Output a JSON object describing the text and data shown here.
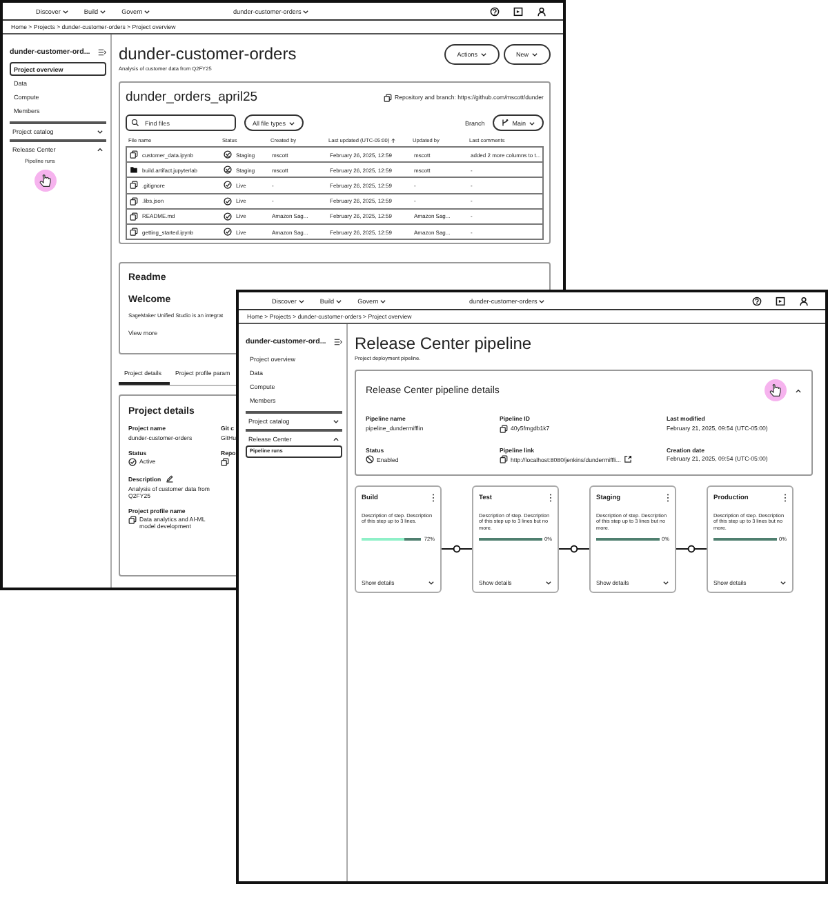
{
  "back_window": {
    "nav": {
      "menus": [
        "Discover",
        "Build",
        "Govern"
      ],
      "project": "dunder-customer-orders"
    },
    "breadcrumb": "Home > Projects > dunder-customer-orders > Project overview",
    "sidebar": {
      "project": "dunder-customer-ord...",
      "items": [
        {
          "label": "Project overview",
          "selected": true
        },
        {
          "label": "Data",
          "selected": false
        },
        {
          "label": "Compute",
          "selected": false
        },
        {
          "label": "Members",
          "selected": false
        }
      ],
      "sections": [
        {
          "label": "Project catalog",
          "expanded": false
        },
        {
          "label": "Release Center",
          "expanded": true,
          "children": [
            {
              "label": "Pipeline runs",
              "selected": false
            }
          ]
        }
      ]
    },
    "title": "dunder-customer-orders",
    "subtitle": "Analysis of customer data from Q2FY25",
    "buttons": [
      "Actions",
      "New"
    ],
    "repository": {
      "name": "dunder_orders_april25",
      "link": "Repository and branch: https://github.com/mscott/dunder",
      "search": {
        "placeholder": "Find files"
      },
      "filter": "All file types",
      "branch_label": "Branch",
      "branch": "Main",
      "columns": [
        {
          "label": "File name",
          "sorted": false
        },
        {
          "label": "Status",
          "sorted": false
        },
        {
          "label": "Created by",
          "sorted": false
        },
        {
          "label": "Last updated (UTC-05:00)",
          "sorted": true
        },
        {
          "label": "Updated by",
          "sorted": false
        },
        {
          "label": "Last comments",
          "sorted": false
        }
      ],
      "rows": [
        {
          "kind": "file",
          "name": "customer_data.ipynb",
          "live": false,
          "status": "Staging",
          "created_by": "mscott",
          "updated": "February 26, 2025, 12:59",
          "updated_by": "mscott",
          "comment": "added 2 more columns to t..."
        },
        {
          "kind": "folder",
          "name": "build.artifact.jupyterlab",
          "live": false,
          "status": "Staging",
          "created_by": "mscott",
          "updated": "February 26, 2025, 12:59",
          "updated_by": "mscott",
          "comment": "-"
        },
        {
          "kind": "file",
          "name": ".gitignore",
          "live": true,
          "status": "Live",
          "created_by": "-",
          "updated": "February 26, 2025, 12:59",
          "updated_by": "-",
          "comment": "-"
        },
        {
          "kind": "file",
          "name": ".libs.json",
          "live": true,
          "status": "Live",
          "created_by": "-",
          "updated": "February 26, 2025, 12:59",
          "updated_by": "-",
          "comment": "-"
        },
        {
          "kind": "file",
          "name": "README.md",
          "live": true,
          "status": "Live",
          "created_by": "Amazon Sag...",
          "updated": "February 26, 2025, 12:59",
          "updated_by": "Amazon Sag...",
          "comment": "-"
        },
        {
          "kind": "file",
          "name": "getting_started.ipynb",
          "live": true,
          "status": "Live",
          "created_by": "Amazon Sag...",
          "updated": "February 26, 2025, 12:59",
          "updated_by": "Amazon Sag...",
          "comment": "-"
        }
      ]
    },
    "readme": {
      "title": "Readme",
      "heading": "Welcome",
      "text": "SageMaker Unified Studio is an integrat",
      "link": "View more"
    },
    "tabs": [
      {
        "label": "Project details",
        "selected": true
      },
      {
        "label": "Project profile param",
        "selected": false
      }
    ],
    "details": {
      "title": "Project details",
      "fields": [
        {
          "label": "Project name",
          "value": "dunder-customer-orders",
          "kind": "text"
        },
        {
          "label": "Status",
          "value": "Active",
          "kind": "status"
        },
        {
          "label": "Description",
          "value": "Analysis of customer data from Q2FY25",
          "kind": "editable"
        },
        {
          "label": "Project profile name",
          "value": "Data analytics and AI-ML model development",
          "kind": "copy"
        }
      ],
      "fields_2": [
        {
          "label": "Git c",
          "value": "GitHu",
          "kind": "text"
        },
        {
          "label": "Repo",
          "kind": "copy"
        }
      ]
    }
  },
  "front_window": {
    "nav": {
      "menus": [
        "Discover",
        "Build",
        "Govern"
      ],
      "project": "dunder-customer-orders"
    },
    "breadcrumb": "Home > Projects > dunder-customer-orders > Project overview",
    "sidebar": {
      "project": "dunder-customer-ord...",
      "items": [
        {
          "label": "Project overview",
          "selected": false
        },
        {
          "label": "Data",
          "selected": false
        },
        {
          "label": "Compute",
          "selected": false
        },
        {
          "label": "Members",
          "selected": false
        }
      ],
      "sections": [
        {
          "label": "Project catalog",
          "expanded": false
        },
        {
          "label": "Release Center",
          "expanded": true,
          "children": [
            {
              "label": "Pipeline runs",
              "selected": true
            }
          ]
        }
      ]
    },
    "title": "Release Center pipeline",
    "subtitle": "Project deployment pipeline.",
    "pipeline": {
      "title": "Release Center pipeline details",
      "expanded": true,
      "fields": [
        {
          "label": "Pipeline name",
          "value": "pipeline_dundermifflin",
          "kind": "text"
        },
        {
          "label": "Pipeline ID",
          "value": "40y5fmgdb1k7",
          "kind": "copy"
        },
        {
          "label": "Last modified",
          "value": "February 21, 2025, 09:54 (UTC-05:00)",
          "kind": "text"
        },
        {
          "label": "Status",
          "value": "Enabled",
          "kind": "status"
        },
        {
          "label": "Pipeline link",
          "value": "http://localhost:8080/jenkins/dundermiffli...",
          "kind": "link"
        },
        {
          "label": "Creation date",
          "value": "February 21, 2025, 09:54 (UTC-05:00)",
          "kind": "text"
        }
      ]
    },
    "stages": [
      {
        "name": "Build",
        "description": "Description of step. Description of this step up to 3 lines.",
        "level": 0.72,
        "percent": "72%",
        "action": "Show details"
      },
      {
        "name": "Test",
        "description": "Description of step. Description of this step up to 3 lines but no more.",
        "level": 0,
        "percent": "0%",
        "action": "Show details"
      },
      {
        "name": "Staging",
        "description": "Description of step. Description of this step up to 3 lines but no more.",
        "level": 0,
        "percent": "0%",
        "action": "Show details"
      },
      {
        "name": "Production",
        "description": "Description of step. Description of this step up to 3 lines but no more.",
        "level": 0,
        "percent": "0%",
        "action": "Show details"
      }
    ]
  }
}
